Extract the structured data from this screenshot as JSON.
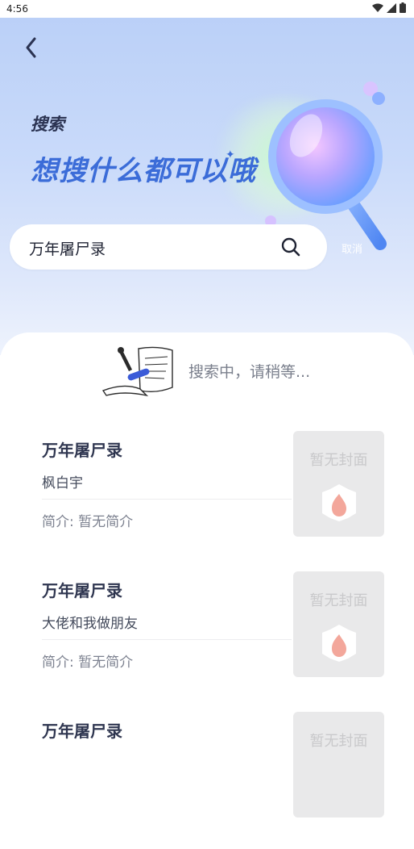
{
  "status_bar": {
    "time": "4:56"
  },
  "header": {
    "title_small": "搜索",
    "title_big": "想搜什么都可以哦"
  },
  "search": {
    "query": "万年屠尸录",
    "cancel_label": "取消"
  },
  "loading": {
    "text": "搜索中，请稍等..."
  },
  "results": [
    {
      "title": "万年屠尸录",
      "author": "枫白宇",
      "intro": "简介: 暂无简介",
      "cover_placeholder": "暂无封面"
    },
    {
      "title": "万年屠尸录",
      "author": "大佬和我做朋友",
      "intro": "简介: 暂无简介",
      "cover_placeholder": "暂无封面"
    },
    {
      "title": "万年屠尸录",
      "author": "",
      "intro": "",
      "cover_placeholder": "暂无封面"
    }
  ],
  "colors": {
    "accent": "#3b6cd8",
    "title_dark": "#2b3352",
    "cover_bg": "#e9e9ea",
    "logo": "#f3a79b"
  }
}
